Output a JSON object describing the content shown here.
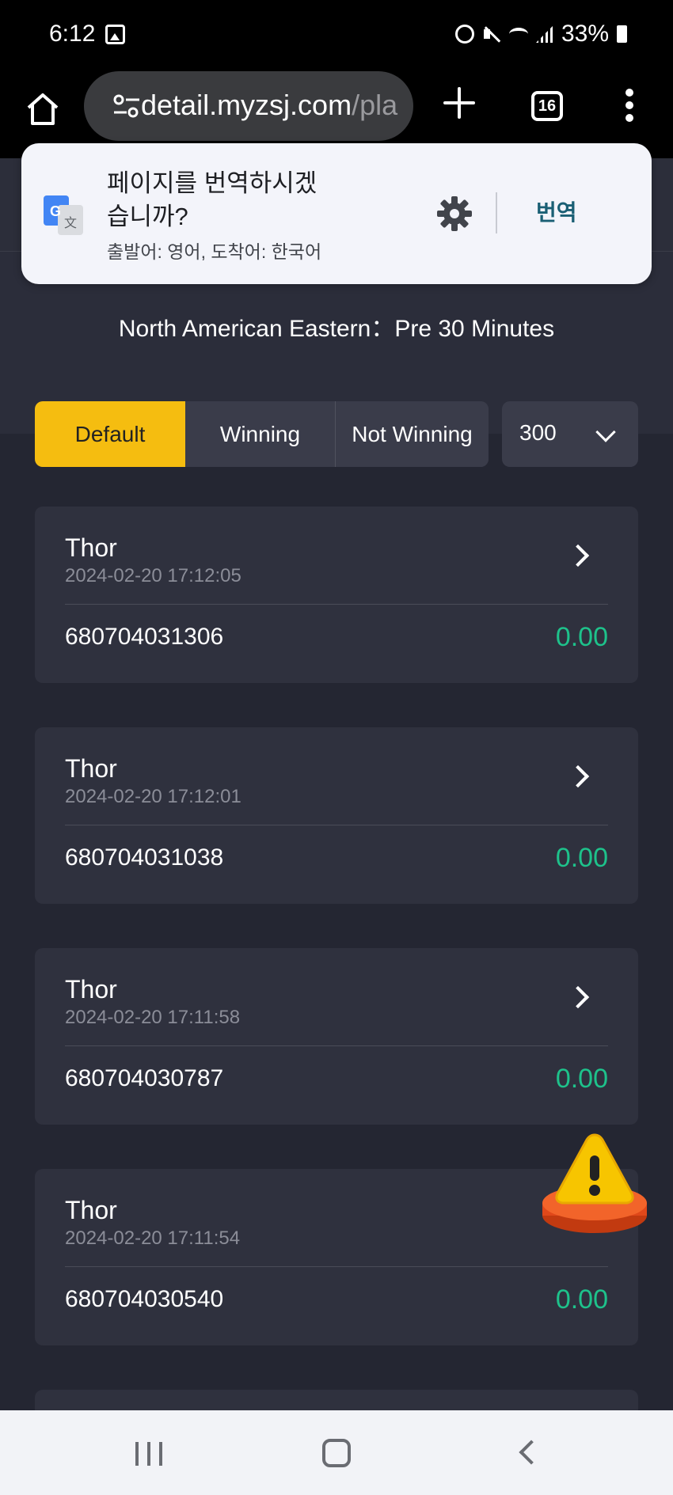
{
  "status_bar": {
    "time": "6:12",
    "battery": "33%",
    "icons": [
      "gallery-icon",
      "alarm-icon",
      "mute-icon",
      "wifi-icon",
      "signal-icon",
      "battery-icon"
    ]
  },
  "browser": {
    "url_host": "detail.myzsj.com",
    "url_path": "/pla",
    "tab_count": "16"
  },
  "translate_bar": {
    "title": "페이지를 번역하시겠습니까?",
    "subtitle": "출발어: 영어, 도착어: 한국어",
    "action": "번역"
  },
  "page": {
    "title": "North American Eastern：Pre 30 Minutes"
  },
  "filters": {
    "tabs": [
      {
        "label": "Default",
        "active": true
      },
      {
        "label": "Winning",
        "active": false
      },
      {
        "label": "Not Winning",
        "active": false
      }
    ],
    "select_value": "300"
  },
  "records": [
    {
      "name": "Thor",
      "date": "2024-02-20 17:12:05",
      "id": "680704031306",
      "amount": "0.00"
    },
    {
      "name": "Thor",
      "date": "2024-02-20 17:12:01",
      "id": "680704031038",
      "amount": "0.00"
    },
    {
      "name": "Thor",
      "date": "2024-02-20 17:11:58",
      "id": "680704030787",
      "amount": "0.00"
    },
    {
      "name": "Thor",
      "date": "2024-02-20 17:11:54",
      "id": "680704030540",
      "amount": "0.00"
    }
  ],
  "colors": {
    "accent": "#f5bd10",
    "amount": "#1ec28b",
    "background": "#242632",
    "card": "#2f313e"
  }
}
